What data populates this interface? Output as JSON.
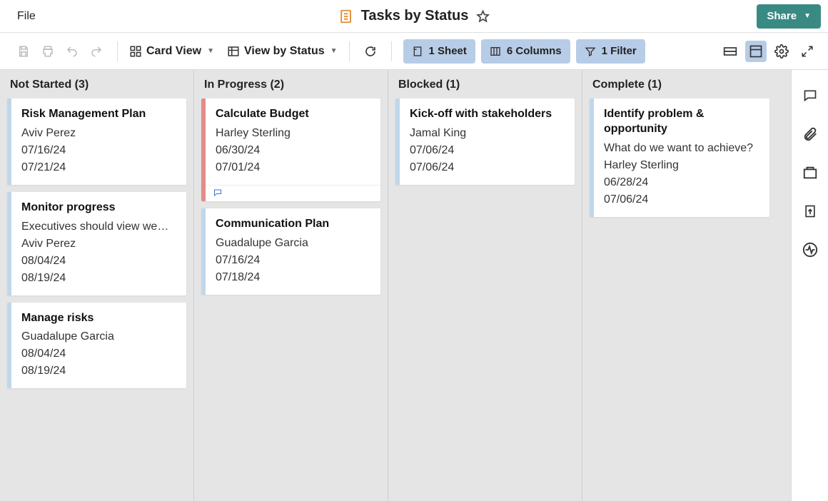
{
  "topbar": {
    "file_label": "File",
    "title": "Tasks by Status",
    "share_label": "Share"
  },
  "toolbar": {
    "card_view_label": "Card View",
    "view_by_status_label": "View by Status",
    "sheet_pill": "1 Sheet",
    "columns_pill": "6 Columns",
    "filter_pill": "1 Filter"
  },
  "board": {
    "lanes": [
      {
        "header": "Not Started (3)",
        "cards": [
          {
            "title": "Risk Management Plan",
            "rows": [
              "Aviv Perez",
              "07/16/24",
              "07/21/24"
            ],
            "accent": "blue"
          },
          {
            "title": "Monitor progress",
            "rows": [
              "Executives should view we…",
              "Aviv Perez",
              "08/04/24",
              "08/19/24"
            ],
            "accent": "blue"
          },
          {
            "title": "Manage risks",
            "rows": [
              "Guadalupe Garcia",
              "08/04/24",
              "08/19/24"
            ],
            "accent": "blue"
          }
        ]
      },
      {
        "header": "In Progress (2)",
        "cards": [
          {
            "title": "Calculate Budget",
            "rows": [
              "Harley Sterling",
              "06/30/24",
              "07/01/24"
            ],
            "accent": "red",
            "has_comment": true
          },
          {
            "title": "Communication Plan",
            "rows": [
              "Guadalupe Garcia",
              "07/16/24",
              "07/18/24"
            ],
            "accent": "blue"
          }
        ]
      },
      {
        "header": "Blocked (1)",
        "cards": [
          {
            "title": "Kick-off with stakeholders",
            "rows": [
              "Jamal King",
              "07/06/24",
              "07/06/24"
            ],
            "accent": "blue"
          }
        ]
      },
      {
        "header": "Complete (1)",
        "cards": [
          {
            "title": "Identify problem & opportunity",
            "rows": [
              "What do we want to achieve?",
              "Harley Sterling",
              "06/28/24",
              "07/06/24"
            ],
            "accent": "blue"
          }
        ]
      }
    ]
  }
}
